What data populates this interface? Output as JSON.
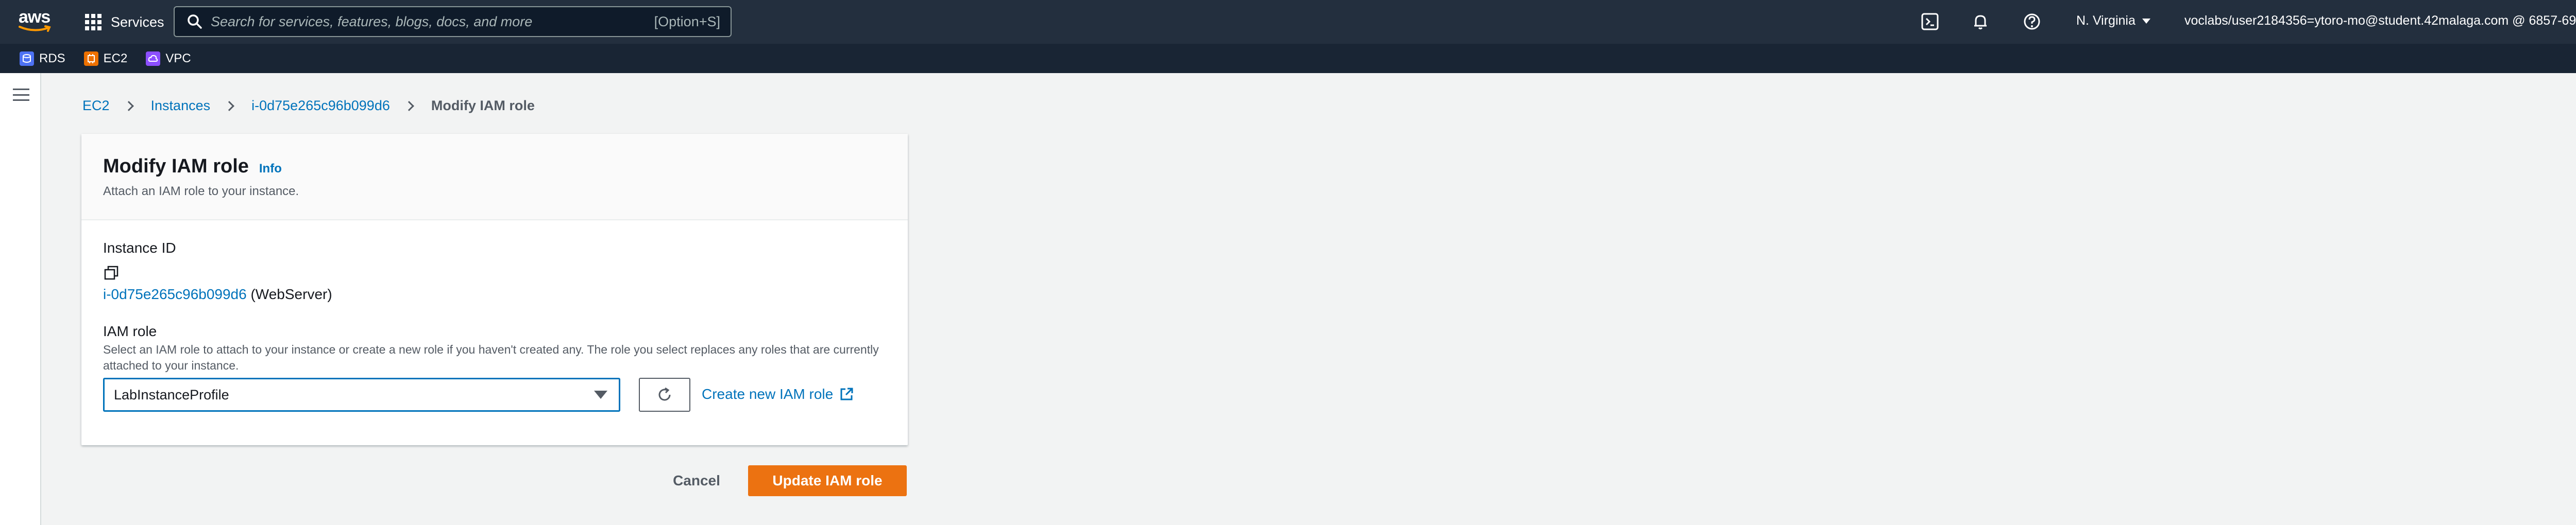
{
  "topnav": {
    "logo_text": "aws",
    "services_label": "Services",
    "search": {
      "placeholder": "Search for services, features, blogs, docs, and more",
      "shortcut": "[Option+S]"
    },
    "region": "N. Virginia",
    "account": "voclabs/user2184356=ytoro-mo@student.42malaga.com @ 6857-6975...",
    "icons": [
      "cloudshell-icon",
      "bell-icon",
      "help-icon"
    ]
  },
  "favorites": [
    {
      "label": "RDS",
      "icon": "rds-icon",
      "color": "#4d72f3"
    },
    {
      "label": "EC2",
      "icon": "ec2-icon",
      "color": "#ed7100"
    },
    {
      "label": "VPC",
      "icon": "vpc-icon",
      "color": "#8c4fff"
    }
  ],
  "breadcrumb": {
    "items": [
      "EC2",
      "Instances",
      "i-0d75e265c96b099d6"
    ],
    "current": "Modify IAM role"
  },
  "panel": {
    "title": "Modify IAM role",
    "info": "Info",
    "description": "Attach an IAM role to your instance.",
    "instance_id_label": "Instance ID",
    "instance_id": "i-0d75e265c96b099d6",
    "instance_name": "(WebServer)",
    "iam_role_label": "IAM role",
    "iam_role_description": "Select an IAM role to attach to your instance or create a new role if you haven't created any. The role you select replaces any roles that are currently attached to your instance.",
    "selected_role": "LabInstanceProfile",
    "create_role_link": "Create new IAM role"
  },
  "actions": {
    "cancel": "Cancel",
    "update": "Update IAM role"
  },
  "colors": {
    "nav_bg": "#232f3e",
    "link": "#0073bb",
    "primary_button": "#ec7211"
  }
}
